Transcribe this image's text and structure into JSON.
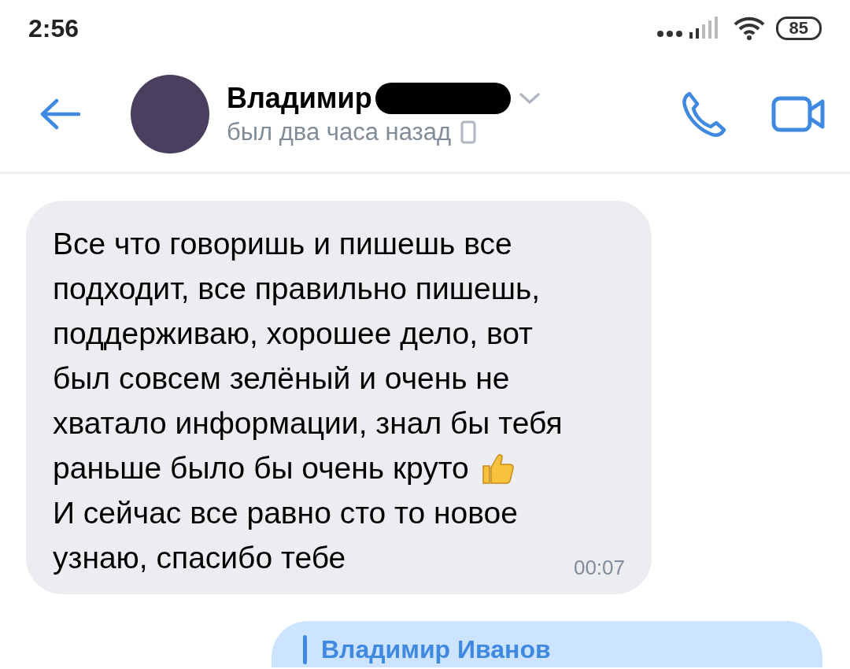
{
  "status_bar": {
    "time": "2:56",
    "battery": "85"
  },
  "header": {
    "name": "Владимир",
    "status": "был два часа назад",
    "name_redacted": true
  },
  "messages": [
    {
      "kind": "incoming",
      "parts": [
        {
          "kind": "text",
          "text": "Все что говоришь и пишешь все\nподходит, все правильно пишешь,\nподдерживаю, хорошее дело, вот\nбыл совсем зелёный и очень не\nхватало информации, знал бы тебя\nраньше было бы очень круто"
        },
        {
          "kind": "thumbs_up"
        },
        {
          "kind": "text",
          "text": "И сейчас  все равно сто то новое\nузнаю, спасибо тебе"
        }
      ],
      "time": "00:07"
    },
    {
      "kind": "outgoing",
      "reply_to": "Владимир Иванов"
    }
  ]
}
